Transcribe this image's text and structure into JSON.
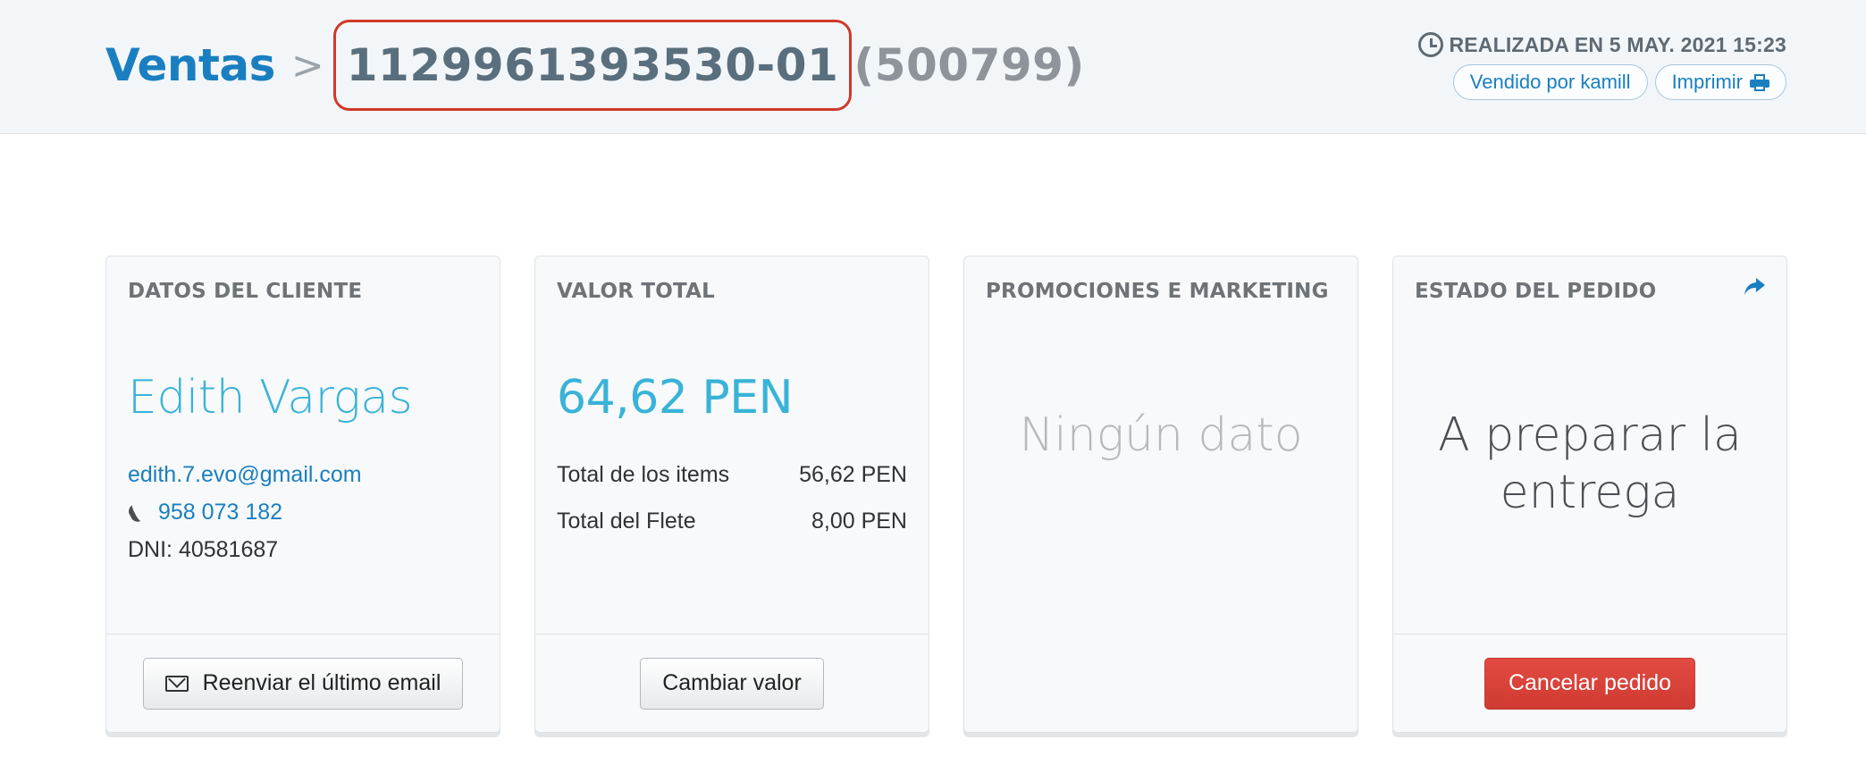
{
  "header": {
    "breadcrumb_root": "Ventas",
    "breadcrumb_separator": ">",
    "order_id": "1129961393530-01",
    "order_sequence": "(500799)",
    "created_label": "REALIZADA EN 5 MAY. 2021 15:23",
    "seller_button": "Vendido por kamill",
    "print_button": "Imprimir",
    "icons": [
      "clock-icon",
      "printer-icon"
    ],
    "colors": {
      "accent": "#1a7fc1",
      "highlight_border": "#d0392b"
    }
  },
  "cards": {
    "customer": {
      "title": "DATOS DEL CLIENTE",
      "name": "Edith Vargas",
      "email": "edith.7.evo@gmail.com",
      "phone": "958 073 182",
      "dni": "DNI: 40581687",
      "resend_button": "Reenviar el último email"
    },
    "total": {
      "title": "VALOR TOTAL",
      "amount": "64,62 PEN",
      "items_label": "Total de los items",
      "items_value": "56,62 PEN",
      "freight_label": "Total del Flete",
      "freight_value": "8,00 PEN",
      "change_button": "Cambiar valor"
    },
    "promotions": {
      "title": "PROMOCIONES E MARKETING",
      "empty_text": "Ningún dato"
    },
    "status": {
      "title": "ESTADO DEL PEDIDO",
      "status_line1": "A preparar la",
      "status_line2": "entrega",
      "cancel_button": "Cancelar pedido",
      "colors": {
        "cancel": "#d9413a"
      }
    }
  }
}
